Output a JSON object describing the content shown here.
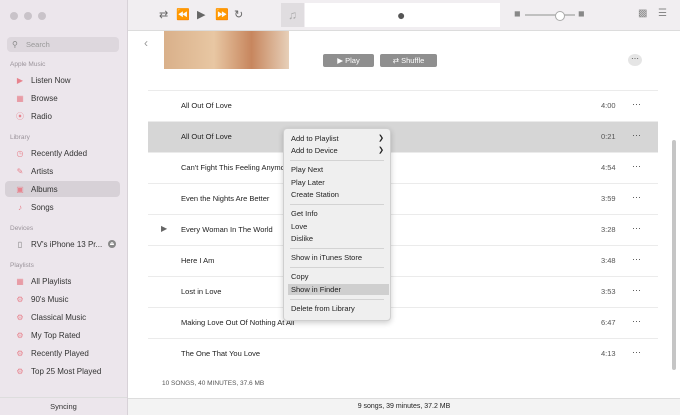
{
  "sidebar": {
    "search_placeholder": "Search",
    "sections": {
      "apple_music": "Apple Music",
      "library": "Library",
      "devices": "Devices",
      "playlists": "Playlists"
    },
    "apple_music_items": [
      {
        "label": "Listen Now",
        "icon": "play-circle-icon"
      },
      {
        "label": "Browse",
        "icon": "grid-icon"
      },
      {
        "label": "Radio",
        "icon": "radio-icon"
      }
    ],
    "library_items": [
      {
        "label": "Recently Added",
        "icon": "clock-icon"
      },
      {
        "label": "Artists",
        "icon": "mic-icon"
      },
      {
        "label": "Albums",
        "icon": "album-icon",
        "selected": true
      },
      {
        "label": "Songs",
        "icon": "note-icon"
      }
    ],
    "device": {
      "label": "RV's iPhone 13 Pr..."
    },
    "playlist_items": [
      {
        "label": "All Playlists"
      },
      {
        "label": "90's Music"
      },
      {
        "label": "Classical Music"
      },
      {
        "label": "My Top Rated"
      },
      {
        "label": "Recently Played"
      },
      {
        "label": "Top 25 Most Played"
      }
    ],
    "syncing": "Syncing"
  },
  "content": {
    "play_label": "Play",
    "shuffle_label": "Shuffle",
    "tracks": [
      {
        "title": "All Out Of Love",
        "time": "4:00"
      },
      {
        "title": "All Out Of Love",
        "time": "0:21"
      },
      {
        "title": "Can't Fight This Feeling Anymore",
        "time": "4:54"
      },
      {
        "title": "Even the Nights Are Better",
        "time": "3:59"
      },
      {
        "title": "Every Woman In The World",
        "time": "3:28"
      },
      {
        "title": "Here I Am",
        "time": "3:48"
      },
      {
        "title": "Lost in Love",
        "time": "3:53"
      },
      {
        "title": "Making Love Out Of Nothing At All",
        "time": "6:47"
      },
      {
        "title": "The One That You Love",
        "time": "4:13"
      }
    ],
    "summary": "10 SONGS, 40 MINUTES, 37.6 MB"
  },
  "status": "9 songs, 39 minutes, 37.2 MB",
  "context_menu": {
    "add_to_playlist": "Add to Playlist",
    "add_to_device": "Add to Device",
    "play_next": "Play Next",
    "play_later": "Play Later",
    "create_station": "Create Station",
    "get_info": "Get Info",
    "love": "Love",
    "dislike": "Dislike",
    "show_itunes_store": "Show in iTunes Store",
    "copy": "Copy",
    "show_in_finder": "Show in Finder",
    "delete_from_library": "Delete from Library"
  },
  "colors": {
    "accent": "#e7838e",
    "selection": "#d6d6d6"
  }
}
